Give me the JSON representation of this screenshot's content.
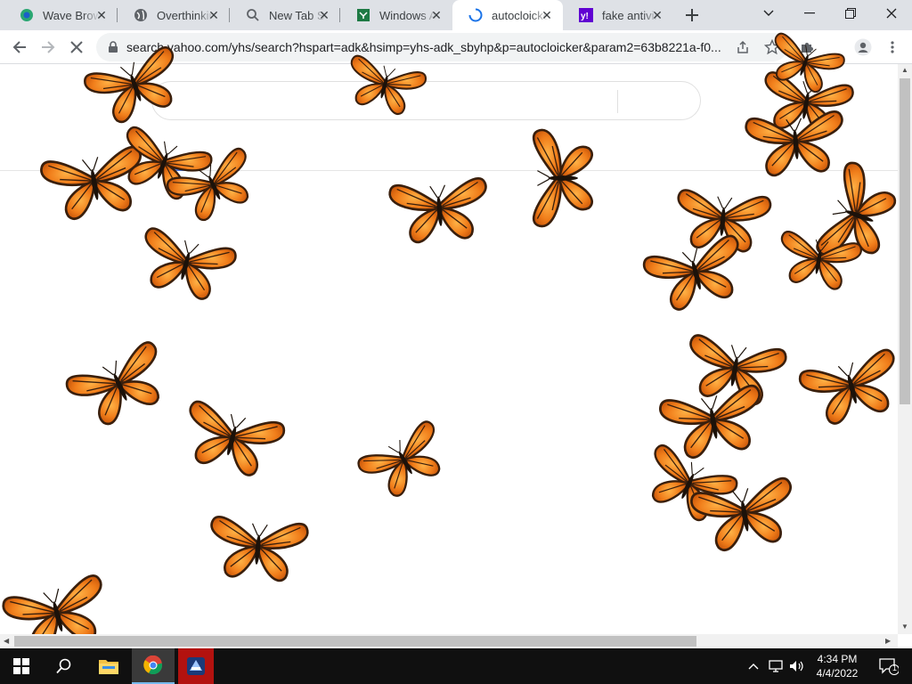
{
  "tabs": [
    {
      "title": "Wave Browser",
      "icon": "wave-browser-icon"
    },
    {
      "title": "Overthinking",
      "icon": "globe-icon"
    },
    {
      "title": "New Tab Search",
      "icon": "search-icon"
    },
    {
      "title": "Windows Apps",
      "icon": "windows-app-icon"
    },
    {
      "title": "autocloicker",
      "icon": "loading-spinner-icon",
      "active": true
    },
    {
      "title": "fake antivirus",
      "icon": "yahoo-icon"
    }
  ],
  "omnibox": {
    "url": "search.yahoo.com/yhs/search?hspart=adk&hsimp=yhs-adk_sbyhp&p=autocloicker&param2=63b8221a-f0..."
  },
  "taskbar": {
    "time": "4:34 PM",
    "date": "4/4/2022",
    "notification_count": "1"
  },
  "colors": {
    "tabstrip": "#dee1e6",
    "butterfly_orange": "#f07d1a",
    "butterfly_dark": "#3a1f0c",
    "taskbar": "#101010"
  }
}
